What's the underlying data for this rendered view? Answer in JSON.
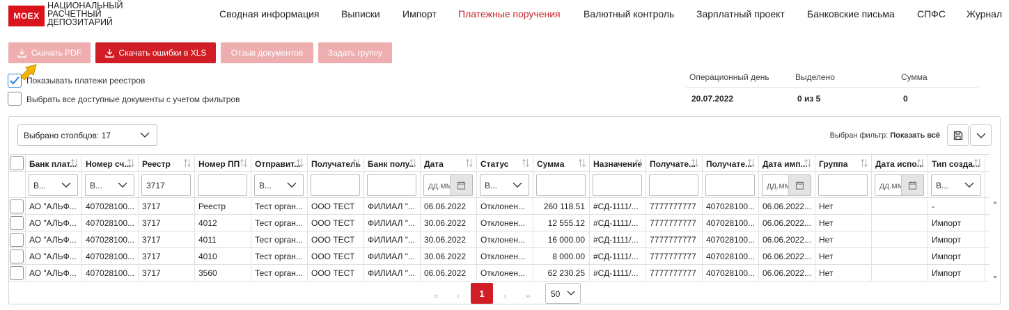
{
  "logo": {
    "box": "MOEX",
    "line1": "НАЦИОНАЛЬНЫЙ",
    "line2": "РАСЧЕТНЫЙ",
    "line3": "ДЕПОЗИТАРИЙ"
  },
  "nav": [
    {
      "label": "Сводная информация",
      "active": false
    },
    {
      "label": "Выписки",
      "active": false
    },
    {
      "label": "Импорт",
      "active": false
    },
    {
      "label": "Платежные поручения",
      "active": true
    },
    {
      "label": "Валютный контроль",
      "active": false
    },
    {
      "label": "Зарплатный проект",
      "active": false
    },
    {
      "label": "Банковские письма",
      "active": false
    },
    {
      "label": "СПФС",
      "active": false
    },
    {
      "label": "Журнал",
      "active": false
    }
  ],
  "toolbar": {
    "download_pdf": "Скачать PDF",
    "download_errors_xls": "Скачать ошибки в XLS",
    "recall": "Отзыв документов",
    "set_group": "Задать группу"
  },
  "options": {
    "show_registry_payments": "Показывать платежи реестров",
    "show_registry_payments_checked": true,
    "select_all_filtered": "Выбрать все доступные документы с учетом фильтров",
    "select_all_filtered_checked": false
  },
  "summary": {
    "op_day_label": "Операционный день",
    "selected_label": "Выделено",
    "sum_label": "Сумма",
    "op_day_value": "20.07.2022",
    "selected_value": "0 из 5",
    "sum_value": "0"
  },
  "grid_toolbar": {
    "columns_selected": "Выбрано столбцов: 17",
    "filter_prefix": "Выбран фильтр:",
    "filter_value": "Показать всё"
  },
  "columns": [
    {
      "label": "Банк плат..."
    },
    {
      "label": "Номер сч..."
    },
    {
      "label": "Реестр"
    },
    {
      "label": "Номер ПП"
    },
    {
      "label": "Отправит..."
    },
    {
      "label": "Получатель"
    },
    {
      "label": "Банк полу..."
    },
    {
      "label": "Дата"
    },
    {
      "label": "Статус"
    },
    {
      "label": "Сумма"
    },
    {
      "label": "Назначение"
    },
    {
      "label": "Получате..."
    },
    {
      "label": "Получате..."
    },
    {
      "label": "Дата имп..."
    },
    {
      "label": "Группа"
    },
    {
      "label": "Дата испо..."
    },
    {
      "label": "Тип созда..."
    }
  ],
  "filters": {
    "select_placeholder": "В...",
    "registry_value": "3717",
    "date_placeholder": "дд.мм"
  },
  "rows": [
    [
      "АО \"АЛЬФ...",
      "407028100...",
      "3717",
      "Реестр",
      "Тест орган...",
      "ООО ТЕСТ",
      "ФИЛИАЛ \"...",
      "06.06.2022",
      "Отклонен...",
      "260 118.51",
      "#СД-1111/...",
      "7777777777",
      "407028100...",
      "06.06.2022...",
      "Нет",
      "",
      "-"
    ],
    [
      "АО \"АЛЬФ...",
      "407028100...",
      "3717",
      "4012",
      "Тест орган...",
      "ООО ТЕСТ",
      "ФИЛИАЛ \"...",
      "30.06.2022",
      "Отклонен...",
      "12 555.12",
      "#СД-1111/...",
      "7777777777",
      "407028100...",
      "06.06.2022...",
      "Нет",
      "",
      "Импорт"
    ],
    [
      "АО \"АЛЬФ...",
      "407028100...",
      "3717",
      "4011",
      "Тест орган...",
      "ООО ТЕСТ",
      "ФИЛИАЛ \"...",
      "30.06.2022",
      "Отклонен...",
      "16 000.00",
      "#СД-1111/...",
      "7777777777",
      "407028100...",
      "06.06.2022...",
      "Нет",
      "",
      "Импорт"
    ],
    [
      "АО \"АЛЬФ...",
      "407028100...",
      "3717",
      "4010",
      "Тест орган...",
      "ООО ТЕСТ",
      "ФИЛИАЛ \"...",
      "30.06.2022",
      "Отклонен...",
      "8 000.00",
      "#СД-1111/...",
      "7777777777",
      "407028100...",
      "06.06.2022...",
      "Нет",
      "",
      "Импорт"
    ],
    [
      "АО \"АЛЬФ...",
      "407028100...",
      "3717",
      "3560",
      "Тест орган...",
      "ООО ТЕСТ",
      "ФИЛИАЛ \"...",
      "06.06.2022",
      "Отклонен...",
      "62 230.25",
      "#СД-1111/...",
      "7777777777",
      "407028100...",
      "06.06.2022...",
      "Нет",
      "",
      "Импорт"
    ]
  ],
  "pagination": {
    "first": "«",
    "prev": "‹",
    "current": "1",
    "next": "›",
    "last": "»",
    "page_size": "50"
  },
  "colors": {
    "accent": "#d01d26",
    "accent_disabled": "#eeaeb0",
    "active_nav": "#c4262e",
    "checkbox_blue": "#2a7fd4"
  }
}
